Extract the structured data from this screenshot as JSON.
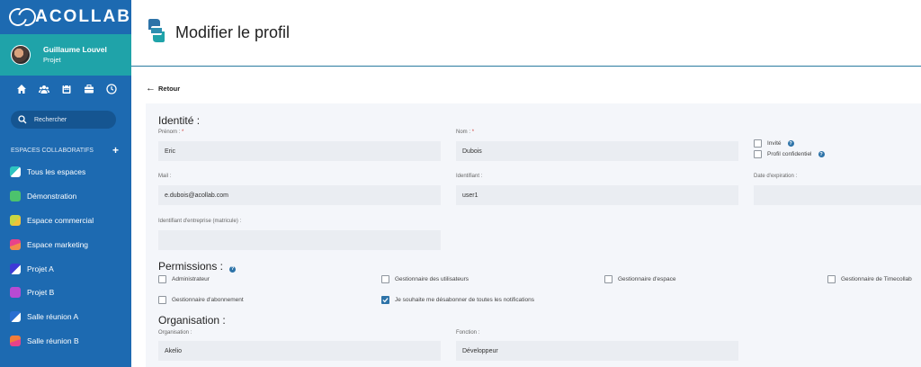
{
  "app": {
    "brand": "ACOLLAB"
  },
  "user": {
    "name": "Guillaume Louvel",
    "role": "Projet"
  },
  "quick_icons": [
    "home-icon",
    "users-icon",
    "calendar-icon",
    "briefcase-icon",
    "clock-icon"
  ],
  "search": {
    "label": "Rechercher"
  },
  "spaces": {
    "heading": "ESPACES COLLABORATIFS",
    "add": "+",
    "items": [
      {
        "label": "Tous les espaces",
        "color": "#2ec4c0"
      },
      {
        "label": "Démonstration",
        "color": "#4cc36d"
      },
      {
        "label": "Espace commercial",
        "color": "#c7d643"
      },
      {
        "label": "Espace marketing",
        "color": "#e8428a"
      },
      {
        "label": "Projet A",
        "color": "#3e3ad6"
      },
      {
        "label": "Projet B",
        "color": "#b84ad3"
      },
      {
        "label": "Salle réunion A",
        "color": "#2a6fd1"
      },
      {
        "label": "Salle réunion B",
        "color": "#f07d3a"
      }
    ]
  },
  "header": {
    "title": "Modifier le profil"
  },
  "back": {
    "label": "Retour"
  },
  "form": {
    "identity": {
      "title": "Identité :",
      "first_name": {
        "label": "Prénom :",
        "req": "*",
        "value": "Eric"
      },
      "last_name": {
        "label": "Nom :",
        "req": "*",
        "value": "Dubois"
      },
      "guest": {
        "label": "Invité",
        "checked": false
      },
      "confidential": {
        "label": "Profil confidentiel",
        "checked": false
      },
      "mail": {
        "label": "Mail :",
        "value": "e.dubois@acollab.com"
      },
      "identifier": {
        "label": "Identifiant :",
        "value": "user1"
      },
      "expiration": {
        "label": "Date d'expiration :",
        "value": ""
      },
      "company_id": {
        "label": "Identifiant d'entreprise (matricule) :",
        "value": ""
      }
    },
    "permissions": {
      "title": "Permissions :",
      "items": [
        {
          "label": "Administrateur",
          "checked": false
        },
        {
          "label": "Gestionnaire des utilisateurs",
          "checked": false
        },
        {
          "label": "Gestionnaire d'espace",
          "checked": false
        },
        {
          "label": "Gestionnaire de Timecollab",
          "checked": false
        },
        {
          "label": "Gestionnaire d'abonnement",
          "checked": false
        },
        {
          "label": "Je souhaite me désabonner de toutes les notifications",
          "checked": true
        }
      ]
    },
    "organisation": {
      "title": "Organisation :",
      "org": {
        "label": "Organisation :",
        "value": "Akelio"
      },
      "function": {
        "label": "Fonction :",
        "value": "Développeur"
      }
    }
  },
  "colors": {
    "sidebar": "#1d6ab1",
    "user_card": "#1fa3a9",
    "accent": "#2d73a8",
    "panel": "#f4f6fa",
    "field": "#eaedf2"
  }
}
